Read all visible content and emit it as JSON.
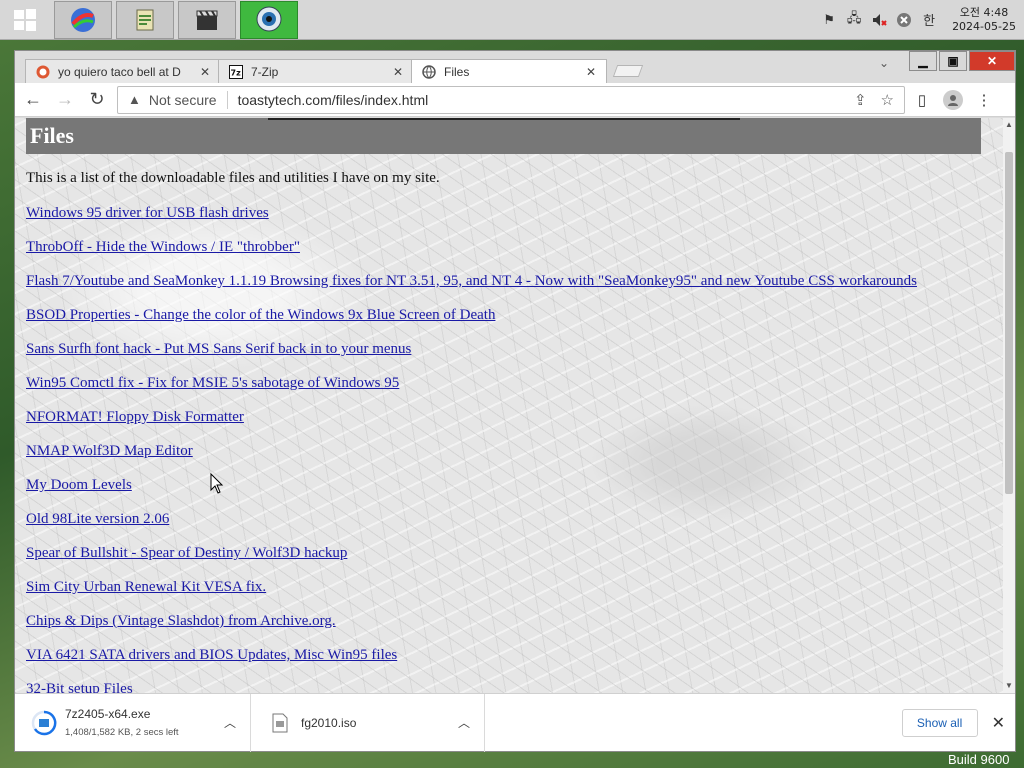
{
  "taskbar": {
    "start": "windows-start-button",
    "apps": [
      {
        "name": "browser-sphere-app",
        "active": false
      },
      {
        "name": "notes-app",
        "active": false
      },
      {
        "name": "video-clapper-app",
        "active": false
      },
      {
        "name": "webcam-app",
        "active": true
      }
    ],
    "clock": {
      "time": "오전 4:48",
      "date": "2024-05-25"
    },
    "ime": "한"
  },
  "browser": {
    "tabs": [
      {
        "title": "yo quiero taco bell at D",
        "icon": "duckduckgo-icon",
        "active": false
      },
      {
        "title": "7-Zip",
        "icon": "7zip-icon",
        "active": false
      },
      {
        "title": "Files",
        "icon": "globe-icon",
        "active": true
      }
    ],
    "omnibox": {
      "security": "Not secure",
      "url": "toastytech.com/files/index.html"
    }
  },
  "page": {
    "title": "Files",
    "intro": "This is a list of the downloadable files and utilities I have on my site.",
    "links": [
      "Windows 95 driver for USB flash drives",
      "ThrobOff - Hide the Windows / IE \"throbber\"",
      "Flash 7/Youtube and SeaMonkey 1.1.19 Browsing fixes for NT 3.51, 95, and NT 4 - Now with \"SeaMonkey95\" and new Youtube CSS workarounds",
      "BSOD Properties - Change the color of the Windows 9x Blue Screen of Death",
      "Sans Surfh font hack - Put MS Sans Serif back in to your menus",
      "Win95 Comctl fix - Fix for MSIE 5's sabotage of Windows 95",
      "NFORMAT! Floppy Disk Formatter",
      "NMAP Wolf3D Map Editor",
      "My Doom Levels",
      "Old 98Lite version 2.06",
      "Spear of Bullshit - Spear of Destiny / Wolf3D hackup",
      "Sim City Urban Renewal Kit VESA fix.",
      "Chips & Dips (Vintage Slashdot) from Archive.org.",
      "VIA 6421 SATA drivers and BIOS Updates, Misc Win95 files",
      "32-Bit setup Files"
    ]
  },
  "downloads": {
    "items": [
      {
        "name": "7z2405-x64.exe",
        "status": "1,408/1,582 KB, 2 secs left"
      },
      {
        "name": "fg2010.iso",
        "status": ""
      }
    ],
    "show_all": "Show all"
  },
  "desktop": {
    "build_text": "Build 9600"
  }
}
